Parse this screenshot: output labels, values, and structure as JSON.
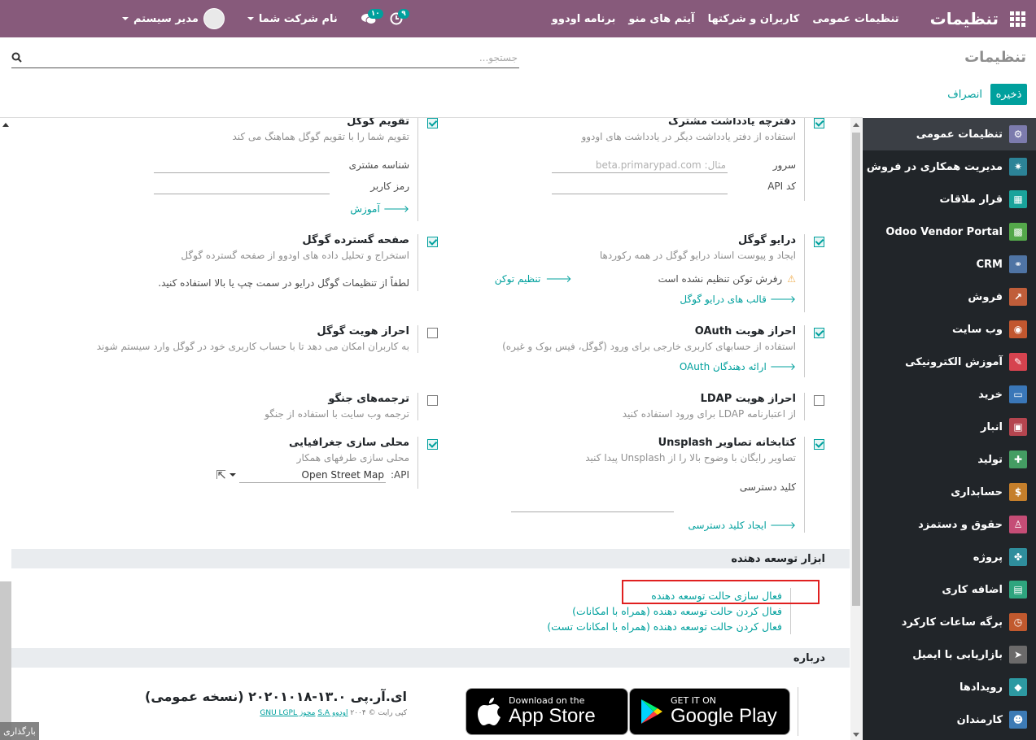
{
  "navbar": {
    "brand": "تنظیمات",
    "menu": [
      "تنظیمات عمومی",
      "کاربران و شرکتها",
      "آیتم های منو",
      "برنامه اودوو"
    ],
    "user": "مدیر سیستم",
    "company": "نام شرکت شما",
    "messages_count": "۱۰",
    "activities_count": "۹"
  },
  "control_panel": {
    "title": "تنظیمات",
    "search_placeholder": "جستجو...",
    "save": "ذخیره",
    "cancel": "انصراف"
  },
  "sidebar": [
    {
      "label": "تنظیمات عمومی",
      "icon": "gear-icon",
      "color": "#7c7bad"
    },
    {
      "label": "مدیریت همکاری در فروش",
      "icon": "network-icon",
      "color": "#2c8397"
    },
    {
      "label": "قرار ملاقات",
      "icon": "calendar-icon",
      "color": "#1aa39b"
    },
    {
      "label": "Odoo Vendor Portal",
      "icon": "grid-icon",
      "color": "#54a84a"
    },
    {
      "label": "CRM",
      "icon": "handshake-icon",
      "color": "#4f74a4"
    },
    {
      "label": "فروش",
      "icon": "chart-icon",
      "color": "#c05e3a"
    },
    {
      "label": "وب سایت",
      "icon": "globe-icon",
      "color": "#c2572f"
    },
    {
      "label": "آموزش الکترونیکی",
      "icon": "elearning-icon",
      "color": "#d6434f"
    },
    {
      "label": "خرید",
      "icon": "card-icon",
      "color": "#3a77b8"
    },
    {
      "label": "انبار",
      "icon": "box-icon",
      "color": "#b4454f"
    },
    {
      "label": "تولید",
      "icon": "wrench-icon",
      "color": "#449d63"
    },
    {
      "label": "حسابداری",
      "icon": "invoice-icon",
      "color": "#c57f2b"
    },
    {
      "label": "حقوق و دستمزد",
      "icon": "payroll-icon",
      "color": "#c54d76"
    },
    {
      "label": "پروژه",
      "icon": "puzzle-icon",
      "color": "#2f8e9c"
    },
    {
      "label": "اضافه کاری",
      "icon": "overtime-icon",
      "color": "#2ea57e"
    },
    {
      "label": "برگه ساعات کارکرد",
      "icon": "stopwatch-icon",
      "color": "#c1592e"
    },
    {
      "label": "بازاریابی با ایمیل",
      "icon": "paper-plane-icon",
      "color": "#6b6a6a"
    },
    {
      "label": "رویدادها",
      "icon": "ticket-icon",
      "color": "#2d99a1"
    },
    {
      "label": "کارمندان",
      "icon": "people-icon",
      "color": "#3d7bb5"
    }
  ],
  "settings": {
    "pad": {
      "title": "دفترچه یادداشت مشترک",
      "desc": "استفاده از دفتر یادداشت دیگر در یادداشت های اودوو",
      "server_label": "سرور",
      "server_placeholder": "مثال: beta.primarypad.com",
      "api_label": "کد API"
    },
    "gcal": {
      "title": "تقویم گوگل",
      "desc": "تقویم شما را با تقویم گوگل هماهنگ می کند",
      "client_id": "شناسه مشتری",
      "client_secret": "رمز کاربر",
      "tutorial": "آموزش"
    },
    "gdrive": {
      "title": "درایو گوگل",
      "desc": "ایجاد و پیوست اسناد درایو گوگل در همه رکوردها",
      "token_warning": "رفرش توکن تنظیم نشده است",
      "set_token": "تنظیم توکن",
      "templates": "قالب های درایو گوگل"
    },
    "gsheet": {
      "title": "صفحه گسترده گوگل",
      "desc": "استخراج و تحلیل داده های اودوو از صفحه گسترده گوگل",
      "note": "لطفاً از تنظیمات گوگل درایو در سمت چپ یا بالا استفاده کنید."
    },
    "oauth": {
      "title": "احراز هویت OAuth",
      "desc": "استفاده از حسابهای کاربری خارجی برای ورود (گوگل، فیس بوک و غیره)",
      "providers": "ارائه دهندگان OAuth"
    },
    "gauth": {
      "title": "احراز هویت گوگل",
      "desc": "به کاربران امکان می دهد تا با حساب کاربری خود در گوگل وارد سیستم شوند"
    },
    "ldap": {
      "title": "احراز هویت LDAP",
      "desc": "از اعتبارنامه LDAP برای ورود استفاده کنید"
    },
    "jungo": {
      "title": "ترجمه‌های جنگو",
      "desc": "ترجمه وب سایت با استفاده از جنگو"
    },
    "unsplash": {
      "title": "کتابخانه تصاویر Unsplash",
      "desc": "تصاویر رایگان با وضوح بالا را از Unsplash پیدا کنید",
      "access_key": "کلید دسترسی",
      "generate": "ایجاد کلید دسترسی"
    },
    "geo": {
      "title": "محلی سازی جغرافیایی",
      "desc": "محلی سازی طرفهای همکار",
      "api_label": "API:",
      "api_value": "Open Street Map"
    }
  },
  "developer": {
    "heading": "ابزار توسعه دهنده",
    "links": [
      "فعال سازی حالت توسعه دهنده",
      "فعال کردن حالت توسعه دهنده (همراه با امکانات)",
      "فعال کردن حالت توسعه دهنده (همراه با امکانات تست)"
    ]
  },
  "about": {
    "heading": "درباره",
    "version": "ای.آر.پی ۱۳.۰-۲۰۲۰۱۰۱۸ (نسخه عمومی)",
    "copyright": "کپی رایت © ۲۰۰۴",
    "company_link": "اودوو S.A",
    "license": "مجوز GNU LGPL",
    "appstore_small": "Download on the",
    "appstore_big": "App Store",
    "gplay_small": "GET IT ON",
    "gplay_big": "Google Play"
  },
  "status": {
    "loading": "بارگذاری"
  }
}
